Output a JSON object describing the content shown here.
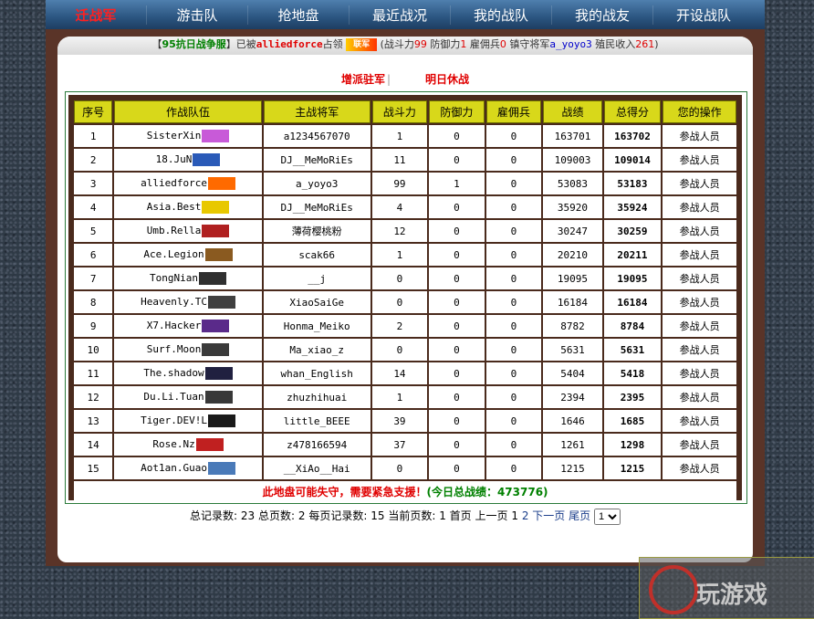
{
  "nav": {
    "logo": "迁战军",
    "items": [
      "游击队",
      "抢地盘",
      "最近战况",
      "我的战队",
      "我的战友",
      "开设战队"
    ]
  },
  "status": {
    "server_open": "【",
    "server": "95抗日战争服",
    "server_close": "】已被",
    "occupier": "alliedforce",
    "occupied_word": "占领",
    "flag_text": "联军",
    "stats_open": "(战斗力",
    "combat": "99",
    "defense_label": "防御力",
    "defense": "1",
    "merc_label": "雇佣兵",
    "merc": "0",
    "garrison_label": "镇守将军",
    "garrison": "a_yoyo3",
    "income_label": "殖民收入",
    "income": "261",
    "stats_close": ")"
  },
  "actions": {
    "send_garrison": "增派驻军",
    "separator": "|",
    "tomorrow": "明日休战"
  },
  "table": {
    "headers": [
      "序号",
      "作战队伍",
      "主战将军",
      "战斗力",
      "防御力",
      "雇佣兵",
      "战绩",
      "总得分",
      "您的操作"
    ],
    "op_label": "参战人员",
    "rows": [
      {
        "no": "1",
        "team": "SisterXin",
        "general": "a1234567070",
        "combat": "1",
        "defense": "0",
        "merc": "0",
        "record": "163701",
        "score": "163702",
        "logo_color": "#c85ad8"
      },
      {
        "no": "2",
        "team": "18.JuN",
        "general": "DJ__MeMoRiEs",
        "combat": "11",
        "defense": "0",
        "merc": "0",
        "record": "109003",
        "score": "109014",
        "logo_color": "#2a5ab8"
      },
      {
        "no": "3",
        "team": "alliedforce",
        "general": "a_yoyo3",
        "combat": "99",
        "defense": "1",
        "merc": "0",
        "record": "53083",
        "score": "53183",
        "logo_color": "#ff6a00"
      },
      {
        "no": "4",
        "team": "Asia.Best",
        "general": "DJ__MeMoRiEs",
        "combat": "4",
        "defense": "0",
        "merc": "0",
        "record": "35920",
        "score": "35924",
        "logo_color": "#e8c800"
      },
      {
        "no": "5",
        "team": "Umb.Rella",
        "general": "薄荷樱桃粉",
        "combat": "12",
        "defense": "0",
        "merc": "0",
        "record": "30247",
        "score": "30259",
        "logo_color": "#b02020"
      },
      {
        "no": "6",
        "team": "Ace.Legion",
        "general": "scak66",
        "combat": "1",
        "defense": "0",
        "merc": "0",
        "record": "20210",
        "score": "20211",
        "logo_color": "#8a5a20"
      },
      {
        "no": "7",
        "team": "TongNian",
        "general": "__j",
        "combat": "0",
        "defense": "0",
        "merc": "0",
        "record": "19095",
        "score": "19095",
        "logo_color": "#303030"
      },
      {
        "no": "8",
        "team": "Heavenly.TC",
        "general": "XiaoSaiGe",
        "combat": "0",
        "defense": "0",
        "merc": "0",
        "record": "16184",
        "score": "16184",
        "logo_color": "#404040"
      },
      {
        "no": "9",
        "team": "X7.Hacker",
        "general": "Honma_Meiko",
        "combat": "2",
        "defense": "0",
        "merc": "0",
        "record": "8782",
        "score": "8784",
        "logo_color": "#5a2a8a"
      },
      {
        "no": "10",
        "team": "Surf.Moon",
        "general": "Ma_xiao_z",
        "combat": "0",
        "defense": "0",
        "merc": "0",
        "record": "5631",
        "score": "5631",
        "logo_color": "#3a3a3a"
      },
      {
        "no": "11",
        "team": "The.shadow",
        "general": "whan_English",
        "combat": "14",
        "defense": "0",
        "merc": "0",
        "record": "5404",
        "score": "5418",
        "logo_color": "#202040"
      },
      {
        "no": "12",
        "team": "Du.Li.Tuan",
        "general": "zhuzhihuai",
        "combat": "1",
        "defense": "0",
        "merc": "0",
        "record": "2394",
        "score": "2395",
        "logo_color": "#383838"
      },
      {
        "no": "13",
        "team": "Tiger.DEV!L",
        "general": "little_BEEE",
        "combat": "39",
        "defense": "0",
        "merc": "0",
        "record": "1646",
        "score": "1685",
        "logo_color": "#1a1a1a"
      },
      {
        "no": "14",
        "team": "Rose.Nz",
        "general": "z478166594",
        "combat": "37",
        "defense": "0",
        "merc": "0",
        "record": "1261",
        "score": "1298",
        "logo_color": "#c02020"
      },
      {
        "no": "15",
        "team": "Aot1an.Guao",
        "general": "__XiAo__Hai",
        "combat": "0",
        "defense": "0",
        "merc": "0",
        "record": "1215",
        "score": "1215",
        "logo_color": "#4a7ab8"
      }
    ],
    "footer_warning": "此地盘可能失守，需要紧急支援！",
    "footer_total": "(今日总战绩：473776)"
  },
  "pager": {
    "total_records_label": "总记录数:",
    "total_records": "23",
    "total_pages_label": "总页数:",
    "total_pages": "2",
    "per_page_label": "每页记录数:",
    "per_page": "15",
    "current_label": "当前页数:",
    "current": "1",
    "first": "首页",
    "prev": "上一页",
    "page1": "1",
    "page2": "2",
    "next": "下一页",
    "last": "尾页",
    "select_value": "1"
  },
  "watermark_text": "玩游戏"
}
